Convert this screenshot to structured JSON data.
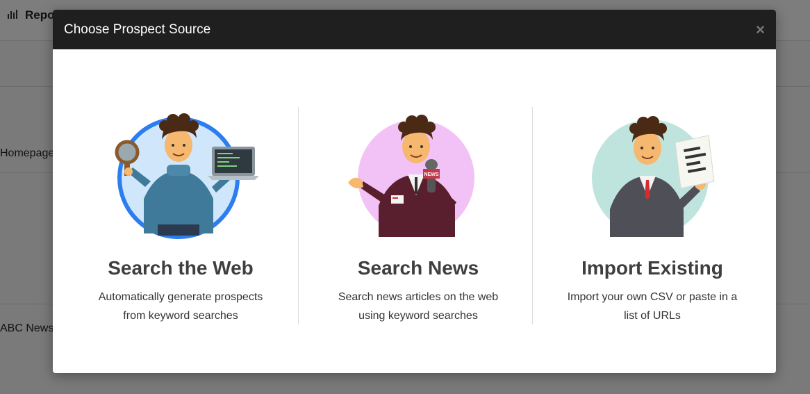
{
  "background": {
    "title": "Repo",
    "rows": [
      "Homepage",
      "ABC News"
    ]
  },
  "modal": {
    "title": "Choose Prospect Source",
    "close_label": "×",
    "options": [
      {
        "title": "Search the Web",
        "description": "Automatically generate prospects from keyword searches",
        "icon": "person-magnifier-laptop-icon"
      },
      {
        "title": "Search News",
        "description": "Search news articles on the web using keyword searches",
        "icon": "news-reporter-icon"
      },
      {
        "title": "Import Existing",
        "description": "Import your own CSV or paste in a list of URLs",
        "icon": "person-document-icon"
      }
    ]
  },
  "colors": {
    "header_bg": "#1f1f1f",
    "web_circle": "#cfe6fb",
    "web_ring": "#2c7df0",
    "news_circle": "#f2c2f6",
    "import_circle": "#bfe4dd"
  }
}
